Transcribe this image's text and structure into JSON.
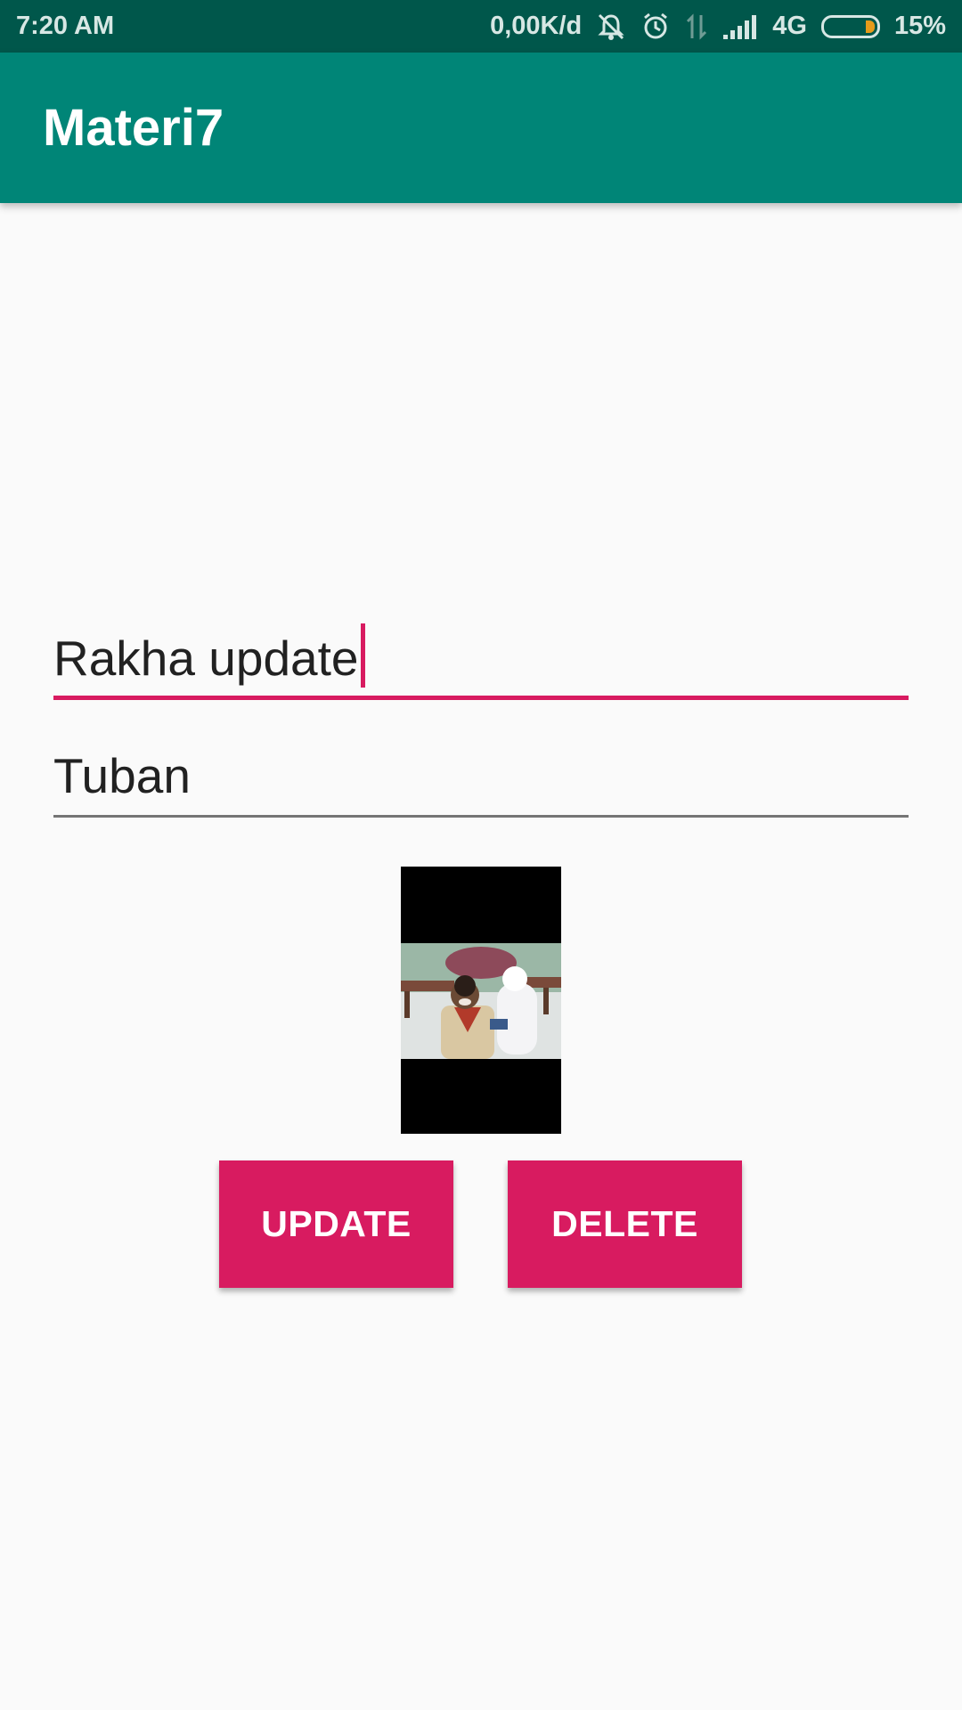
{
  "status_bar": {
    "time": "7:20 AM",
    "network_speed": "0,00K/d",
    "network_type": "4G",
    "battery": "15%",
    "icons": [
      "mute-icon",
      "alarm-icon",
      "data-transfer-icon",
      "signal-icon",
      "battery-icon"
    ]
  },
  "app_bar": {
    "title": "Materi7",
    "color": "#008577"
  },
  "form": {
    "name_value": "Rakha update",
    "city_value": "Tuban",
    "accent": "#d81b60"
  },
  "actions": {
    "update_label": "UPDATE",
    "delete_label": "DELETE"
  }
}
